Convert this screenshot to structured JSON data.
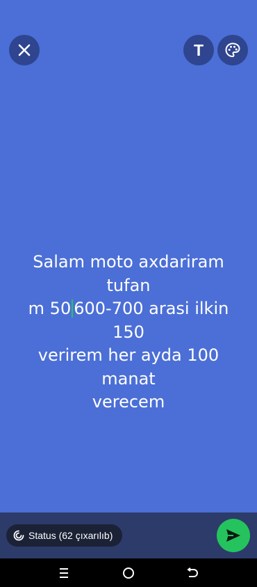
{
  "status_text": {
    "line1": "Salam moto axdariram tufan",
    "line2_before_caret": "m 50",
    "line2_after_caret": "600-700 arasi ilkin 150",
    "line3": "verirem her ayda 100 manat",
    "line4": "verecem"
  },
  "toolbar": {
    "text_button_label": "T",
    "close_icon": "close-icon",
    "text_icon": "text-tool-icon",
    "palette_icon": "palette-icon"
  },
  "bottom_bar": {
    "audience_chip_label": "Status (62 çıxarılıb)",
    "audience_icon": "status-ring-icon",
    "send_icon": "send-icon"
  },
  "nav": {
    "recents_icon": "recents-icon",
    "home_icon": "home-icon",
    "back_icon": "back-icon"
  },
  "colors": {
    "background": "#4b6fd6",
    "button_bg": "#2f4590",
    "bottom_bar": "#2c3b6a",
    "send_button": "#25c35e",
    "caret": "#22c46a"
  }
}
